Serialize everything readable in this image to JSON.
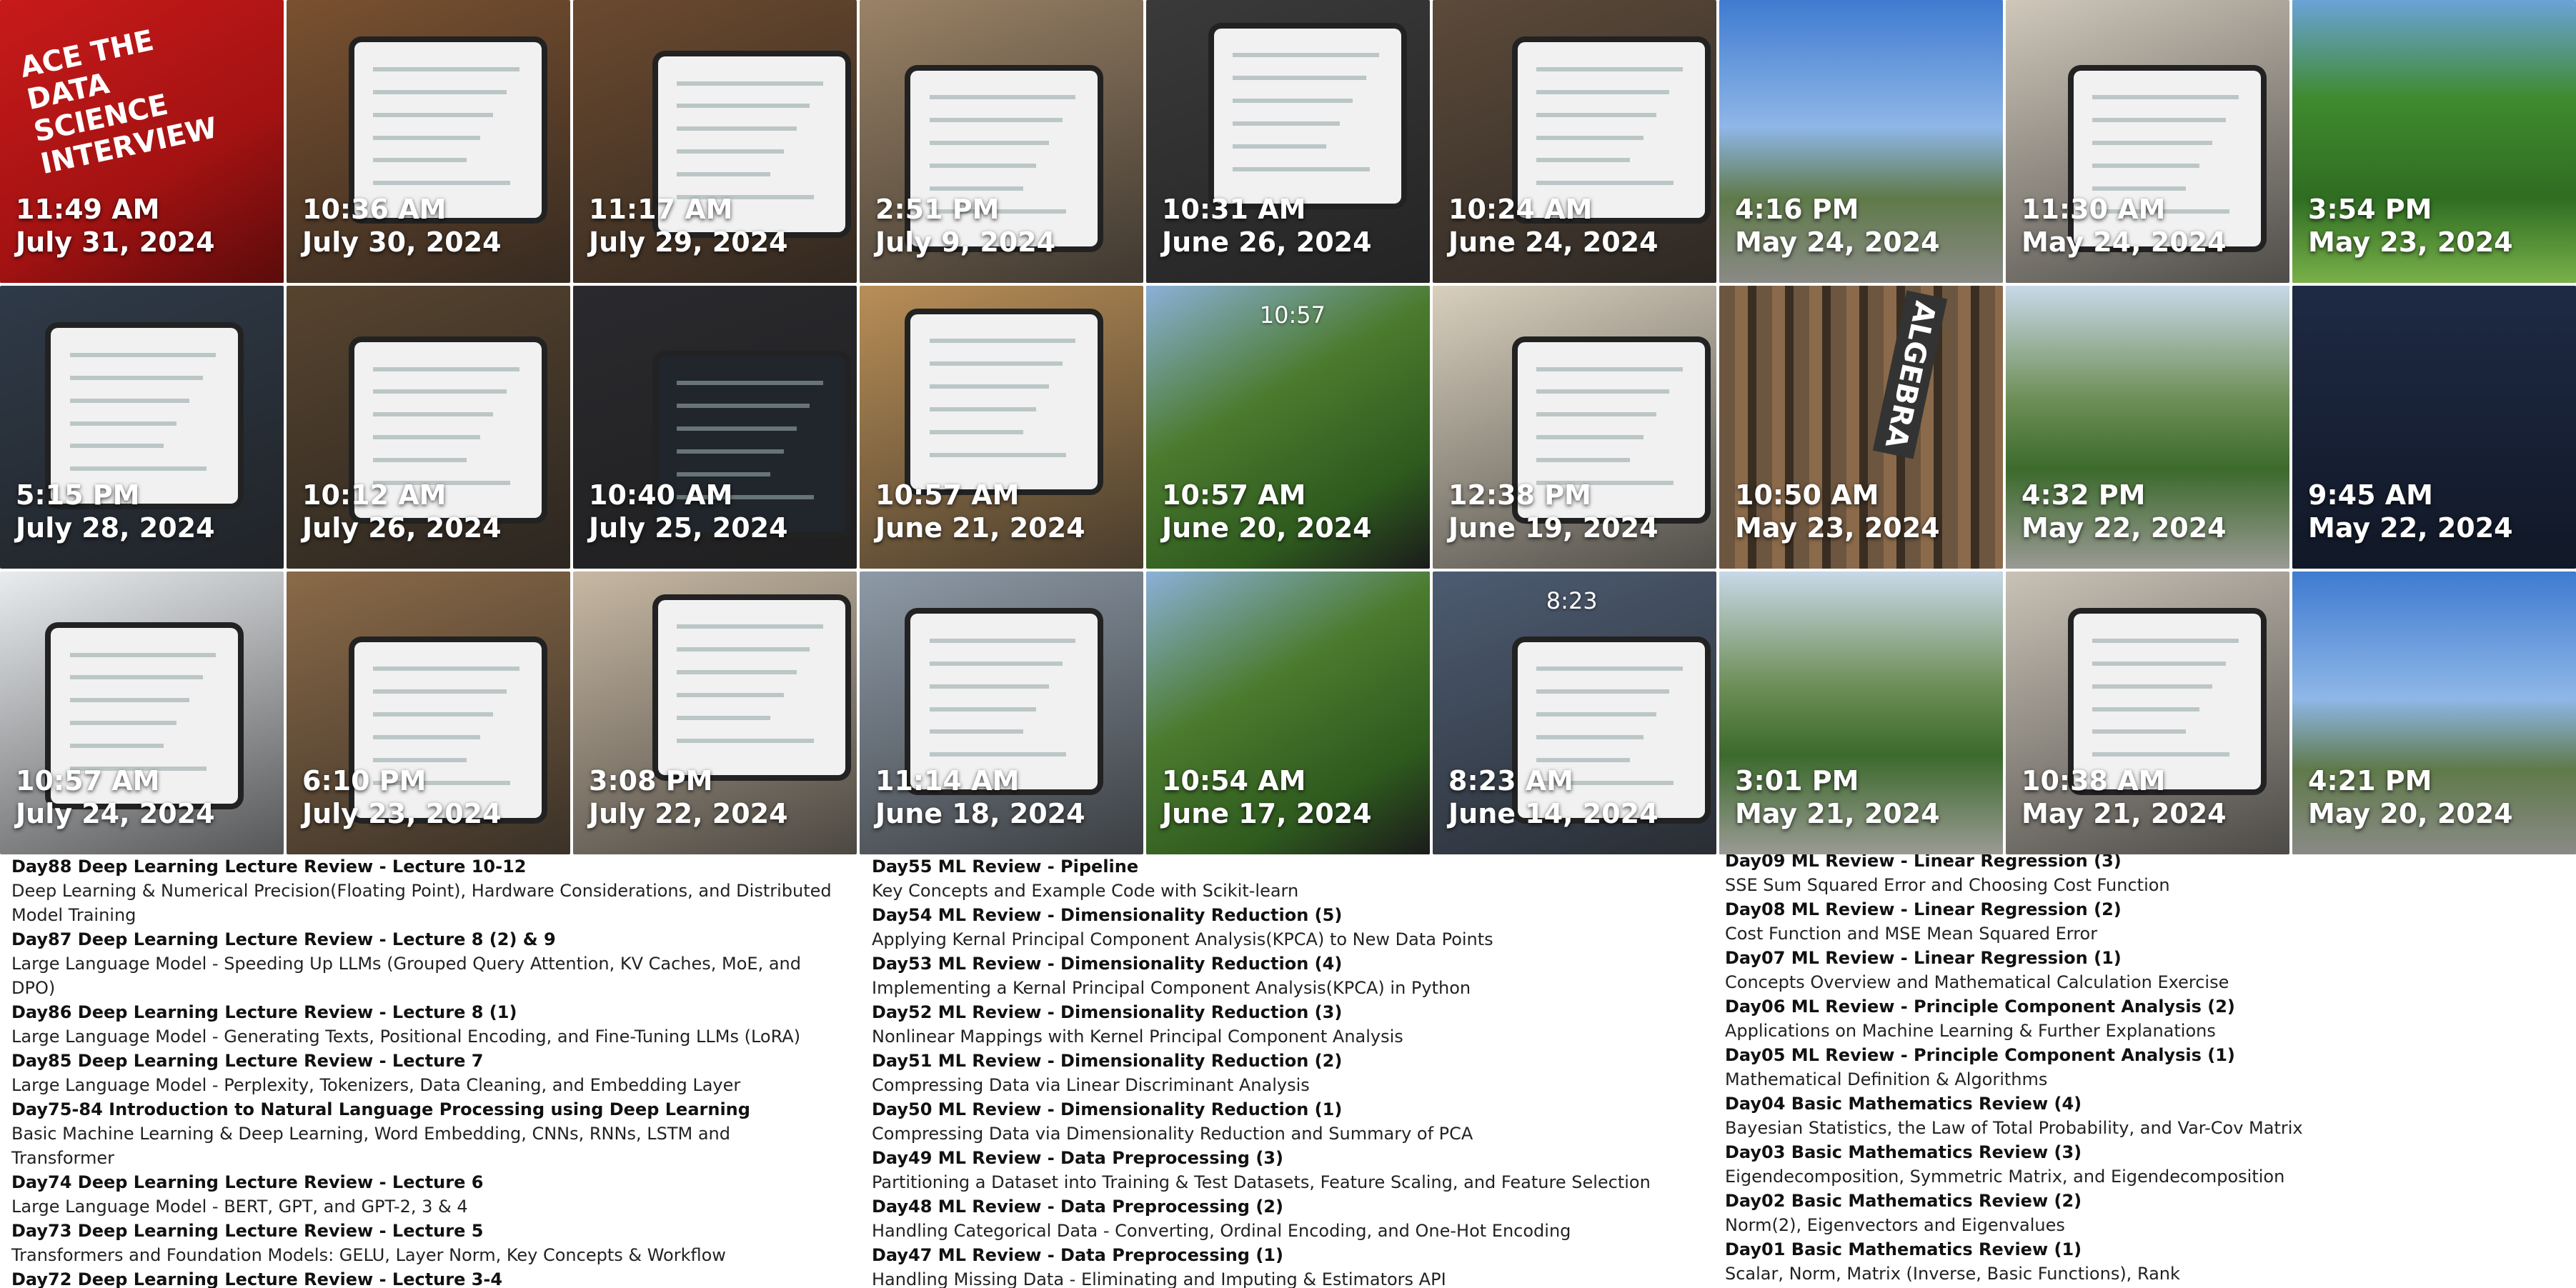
{
  "photos": [
    {
      "time": "11:49 AM",
      "date": "July 31, 2024",
      "bg": "#c81a1a",
      "icon": "book-photo",
      "kind": "book",
      "cover_text": "ACE THE DATA SCIENCE INTERVIEW"
    },
    {
      "time": "10:36 AM",
      "date": "July 30, 2024",
      "bg": "#7a5130",
      "icon": "laptop-photo",
      "kind": "laptop"
    },
    {
      "time": "11:17 AM",
      "date": "July 29, 2024",
      "bg": "#6b4a2f",
      "icon": "tablet-photo",
      "kind": "tablet"
    },
    {
      "time": "2:51 PM",
      "date": "July 9, 2024",
      "bg": "#9a8266",
      "icon": "laptop-photo",
      "kind": "laptop"
    },
    {
      "time": "10:31 AM",
      "date": "June 26, 2024",
      "bg": "#3a3a3a",
      "icon": "laptop-photo",
      "kind": "laptop"
    },
    {
      "time": "10:24 AM",
      "date": "June 24, 2024",
      "bg": "#5c4a3a",
      "icon": "laptop-photo",
      "kind": "laptop"
    },
    {
      "time": "4:16 PM",
      "date": "May 24, 2024",
      "bg": "#3f7bd0",
      "icon": "outdoor-photo",
      "kind": "outdoor-sky"
    },
    {
      "time": "11:30 AM",
      "date": "May 24, 2024",
      "bg": "#cfc7ba",
      "icon": "laptop-photo",
      "kind": "laptop"
    },
    {
      "time": "3:54 PM",
      "date": "May 23, 2024",
      "bg": "#3f8a2e",
      "icon": "trees-photo",
      "kind": "trees"
    },
    {
      "time": "5:15 PM",
      "date": "July 28, 2024",
      "bg": "#2f3a48",
      "icon": "laptop-photo",
      "kind": "laptop"
    },
    {
      "time": "10:12 AM",
      "date": "July 26, 2024",
      "bg": "#57442f",
      "icon": "laptop-photo",
      "kind": "laptop"
    },
    {
      "time": "10:40 AM",
      "date": "July 25, 2024",
      "bg": "#2a2a2e",
      "icon": "laptop-photo",
      "kind": "laptop-dark"
    },
    {
      "time": "10:57 AM",
      "date": "June 21, 2024",
      "bg": "#b88e57",
      "icon": "tablet-photo",
      "kind": "tablet"
    },
    {
      "time": "10:57 AM",
      "date": "June 20, 2024",
      "bg": "#4b7b2e",
      "icon": "wallpaper-photo",
      "kind": "wallpaper",
      "clock": "10:57"
    },
    {
      "time": "12:38 PM",
      "date": "June 19, 2024",
      "bg": "#d8cfbd",
      "icon": "tablet-photo",
      "kind": "tablet"
    },
    {
      "time": "10:50 AM",
      "date": "May 23, 2024",
      "bg": "#6d5640",
      "icon": "book-photo",
      "kind": "library",
      "cover_text": "ALGEBRA"
    },
    {
      "time": "4:32 PM",
      "date": "May 22, 2024",
      "bg": "#6e8f58",
      "icon": "outdoor-photo",
      "kind": "outdoor-path"
    },
    {
      "time": "9:45 AM",
      "date": "May 22, 2024",
      "bg": "#1e2a44",
      "icon": "laptop-photo",
      "kind": "stickers"
    },
    {
      "time": "10:57 AM",
      "date": "July 24, 2024",
      "bg": "#e9ecef",
      "icon": "laptop-photo",
      "kind": "laptop"
    },
    {
      "time": "6:10 PM",
      "date": "July 23, 2024",
      "bg": "#8a6a48",
      "icon": "laptop-photo",
      "kind": "laptop"
    },
    {
      "time": "3:08 PM",
      "date": "July 22, 2024",
      "bg": "#c7b8a3",
      "icon": "tablet-photo",
      "kind": "tablet"
    },
    {
      "time": "11:14 AM",
      "date": "June 18, 2024",
      "bg": "#8e9aa7",
      "icon": "laptop-photo",
      "kind": "laptop"
    },
    {
      "time": "10:54 AM",
      "date": "June 17, 2024",
      "bg": "#384a2e",
      "icon": "wallpaper-photo",
      "kind": "wallpaper"
    },
    {
      "time": "8:23 AM",
      "date": "June 14, 2024",
      "bg": "#4d5c72",
      "icon": "tablet-photo",
      "kind": "tablet",
      "clock": "8:23"
    },
    {
      "time": "3:01 PM",
      "date": "May 21, 2024",
      "bg": "#4c7a3c",
      "icon": "outdoor-photo",
      "kind": "outdoor-path"
    },
    {
      "time": "10:38 AM",
      "date": "May 21, 2024",
      "bg": "#c9c2b6",
      "icon": "laptop-photo",
      "kind": "laptop"
    },
    {
      "time": "4:21 PM",
      "date": "May 20, 2024",
      "bg": "#3d74c9",
      "icon": "outdoor-photo",
      "kind": "outdoor-sky"
    }
  ],
  "posts": {
    "col1": [
      {
        "title": "Day88 Deep Learning Lecture Review - Lecture 10-12",
        "desc": "Deep Learning & Numerical Precision(Floating Point), Hardware Considerations, and Distributed Model Training"
      },
      {
        "title": "Day87 Deep Learning Lecture Review - Lecture 8 (2) & 9",
        "desc": "Large Language Model - Speeding Up LLMs (Grouped Query Attention, KV Caches, MoE, and DPO)"
      },
      {
        "title": "Day86 Deep Learning Lecture Review - Lecture 8 (1)",
        "desc": "Large Language Model - Generating Texts, Positional Encoding, and Fine-Tuning LLMs (LoRA)"
      },
      {
        "title": "Day85 Deep Learning Lecture Review - Lecture 7",
        "desc": "Large Language Model - Perplexity, Tokenizers, Data Cleaning, and Embedding Layer"
      },
      {
        "title": "Day75-84 Introduction to Natural Language Processing using Deep Learning",
        "desc": "Basic Machine Learning & Deep Learning, Word Embedding, CNNs, RNNs, LSTM and Transformer"
      },
      {
        "title": "Day74 Deep Learning Lecture Review - Lecture 6",
        "desc": "Large Language Model - BERT, GPT, and GPT-2, 3 & 4"
      },
      {
        "title": "Day73 Deep Learning Lecture Review - Lecture 5",
        "desc": "Transformers and Foundation Models: GELU, Layer Norm, Key Concepts & Workflow"
      },
      {
        "title": "Day72 Deep Learning Lecture Review - Lecture 3-4",
        "desc": ""
      }
    ],
    "col2": [
      {
        "title": "Day55 ML Review - Pipeline",
        "desc": "Key Concepts and Example Code with Scikit-learn"
      },
      {
        "title": "Day54 ML Review - Dimensionality Reduction (5)",
        "desc": "Applying Kernal Principal Component Analysis(KPCA) to New Data Points"
      },
      {
        "title": "Day53 ML Review - Dimensionality Reduction (4)",
        "desc": "Implementing a Kernal Principal Component Analysis(KPCA) in Python"
      },
      {
        "title": "Day52 ML Review - Dimensionality Reduction (3)",
        "desc": "Nonlinear Mappings with Kernel Principal Component Analysis"
      },
      {
        "title": "Day51 ML Review - Dimensionality Reduction (2)",
        "desc": "Compressing Data via Linear Discriminant Analysis"
      },
      {
        "title": "Day50 ML Review - Dimensionality Reduction (1)",
        "desc": "Compressing Data via Dimensionality Reduction and Summary of PCA"
      },
      {
        "title": "Day49 ML Review - Data Preprocessing (3)",
        "desc": "Partitioning a Dataset into Training & Test Datasets, Feature Scaling, and Feature Selection"
      },
      {
        "title": "Day48 ML Review - Data Preprocessing (2)",
        "desc": "Handling Categorical Data - Converting, Ordinal Encoding, and One-Hot Encoding"
      },
      {
        "title": "Day47 ML Review - Data Preprocessing (1)",
        "desc": "Handling Missing Data - Eliminating and Imputing & Estimators API"
      }
    ],
    "col3": [
      {
        "title": "Day09 ML Review - Linear Regression (3)",
        "desc": "SSE Sum Squared Error and Choosing Cost Function"
      },
      {
        "title": "Day08 ML Review - Linear Regression (2)",
        "desc": "Cost Function and MSE Mean Squared Error"
      },
      {
        "title": "Day07 ML Review - Linear Regression (1)",
        "desc": "Concepts Overview and Mathematical Calculation Exercise"
      },
      {
        "title": "Day06 ML Review - Principle Component Analysis (2)",
        "desc": "Applications on Machine Learning & Further Explanations"
      },
      {
        "title": "Day05 ML Review - Principle Component Analysis (1)",
        "desc": "Mathematical Definition & Algorithms"
      },
      {
        "title": "Day04 Basic Mathematics Review (4)",
        "desc": "Bayesian Statistics, the Law of Total Probability, and Var-Cov Matrix"
      },
      {
        "title": "Day03 Basic Mathematics Review (3)",
        "desc": "Eigendecomposition, Symmetric Matrix, and Eigendecomposition"
      },
      {
        "title": "Day02 Basic Mathematics Review (2)",
        "desc": "Norm(2), Eigenvectors and Eigenvalues"
      },
      {
        "title": "Day01 Basic Mathematics Review (1)",
        "desc": "Scalar, Norm, Matrix (Inverse, Basic Functions), Rank"
      }
    ]
  }
}
